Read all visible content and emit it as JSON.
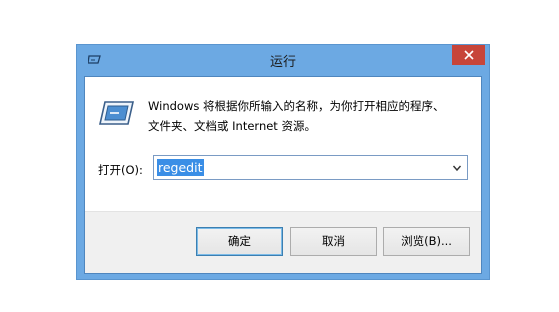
{
  "window": {
    "title": "运行",
    "title_icon": "run-window-icon",
    "close_icon": "close-icon"
  },
  "body": {
    "icon": "run-dialog-icon",
    "desc_line1": "Windows 将根据你所输入的名称，为你打开相应的程序、",
    "desc_line2": "文件夹、文档或 Internet 资源。"
  },
  "open": {
    "label": "打开(O):",
    "value": "regedit",
    "dropdown_icon": "chevron-down-icon"
  },
  "buttons": {
    "ok": "确定",
    "cancel": "取消",
    "browse": "浏览(B)..."
  },
  "colors": {
    "titlebar": "#6ca9e3",
    "close": "#c7453a",
    "selection": "#3a8ee6"
  }
}
